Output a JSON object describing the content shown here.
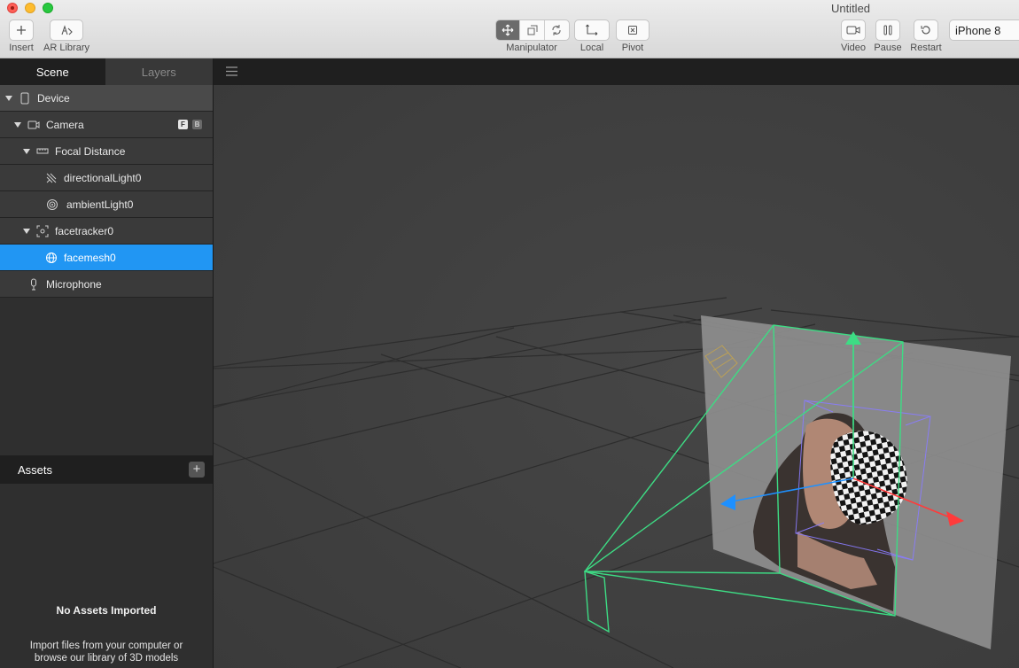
{
  "window": {
    "title": "Untitled"
  },
  "toolbar": {
    "insert": "Insert",
    "ar_library": "AR Library",
    "manipulator": "Manipulator",
    "local": "Local",
    "pivot": "Pivot",
    "video": "Video",
    "pause": "Pause",
    "restart": "Restart",
    "device": "iPhone 8"
  },
  "panel": {
    "tabs": {
      "scene": "Scene",
      "layers": "Layers"
    },
    "tree": [
      {
        "label": "Device",
        "icon": "phone-icon"
      },
      {
        "label": "Camera",
        "icon": "camera-icon",
        "badges": [
          "F",
          "B"
        ]
      },
      {
        "label": "Focal Distance",
        "icon": "ruler-icon"
      },
      {
        "label": "directionalLight0",
        "icon": "directional-light-icon"
      },
      {
        "label": "ambientLight0",
        "icon": "ambient-light-icon"
      },
      {
        "label": "facetracker0",
        "icon": "face-tracker-icon"
      },
      {
        "label": "facemesh0",
        "icon": "globe-icon"
      },
      {
        "label": "Microphone",
        "icon": "microphone-icon"
      }
    ],
    "selected": "facemesh0"
  },
  "assets": {
    "title": "Assets",
    "add": "+",
    "empty_title": "No Assets Imported",
    "empty_body": "Import files from your computer or browse our library of 3D models"
  },
  "colors": {
    "selection": "#2196f3",
    "gizmo_green": "#3ddc84",
    "axis_red": "#ff3b3b",
    "axis_blue": "#1e90ff",
    "bounding_purple": "#8a7cff"
  }
}
